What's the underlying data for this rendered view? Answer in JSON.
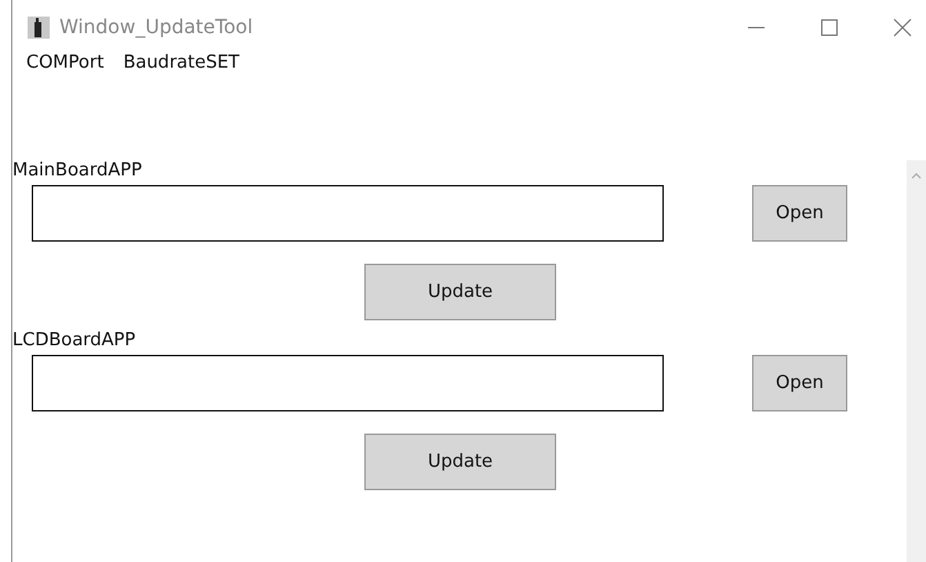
{
  "window": {
    "title": "Window_UpdateTool"
  },
  "menu": [
    "COMPort",
    "BaudrateSET"
  ],
  "sections": [
    {
      "label": "MainBoardAPP",
      "open_button": "Open",
      "update_button": "Update"
    },
    {
      "label": "LCDBoardAPP",
      "open_button": "Open",
      "update_button": "Update"
    }
  ]
}
